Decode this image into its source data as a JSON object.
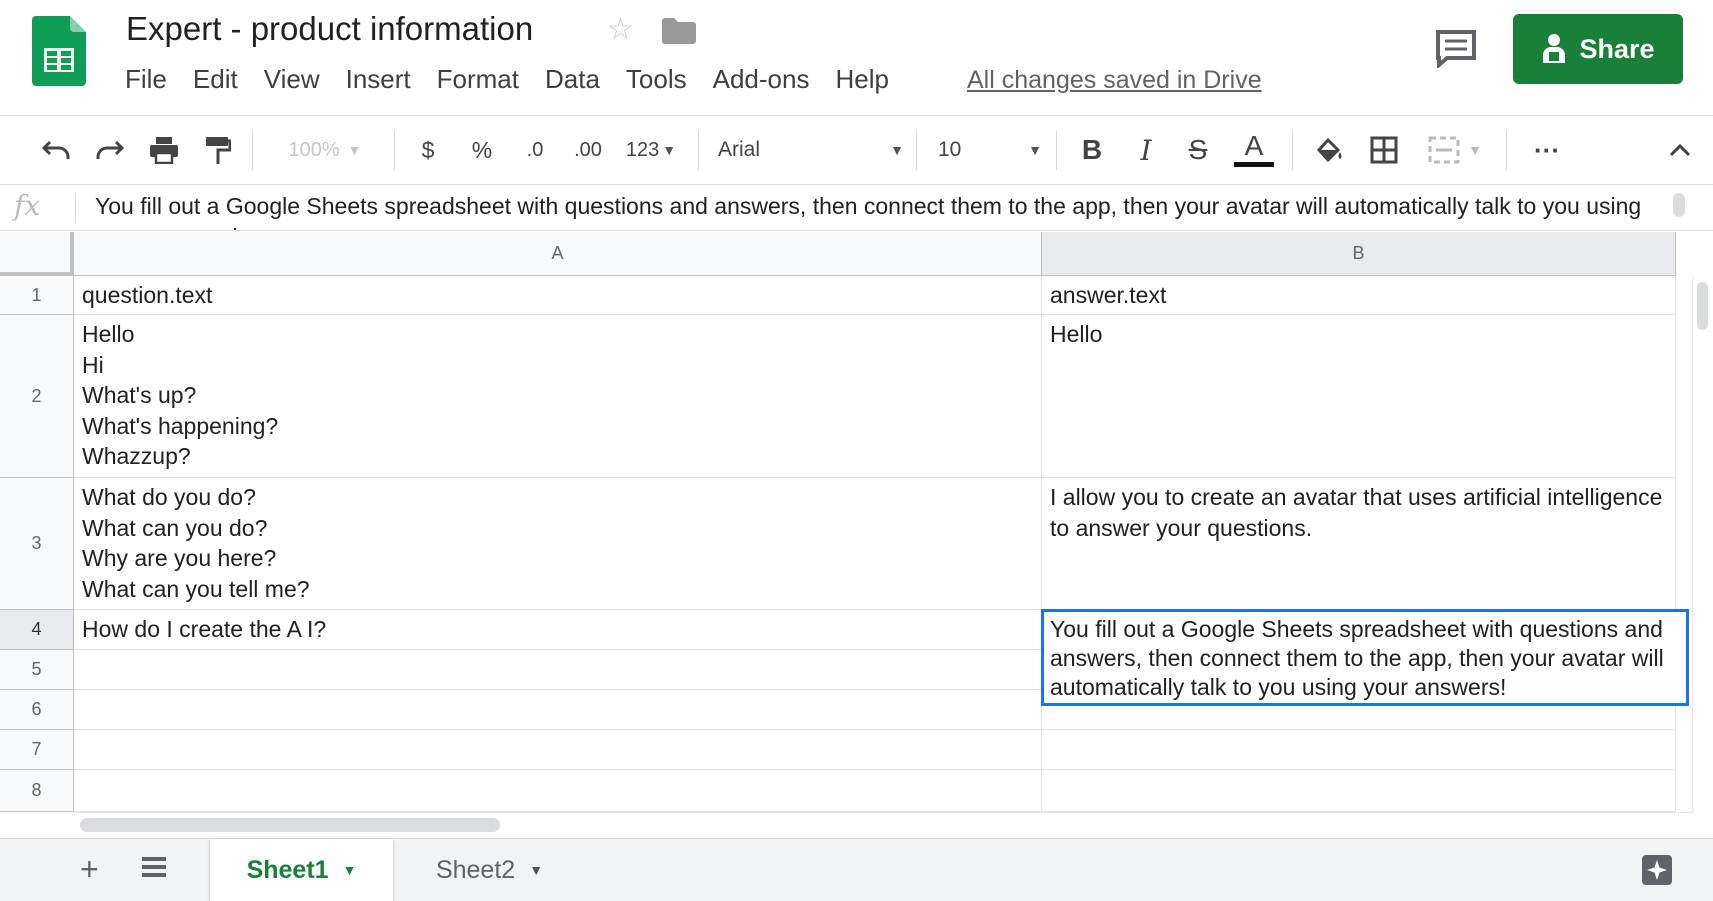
{
  "header": {
    "title": "Expert - product information",
    "menu": [
      "File",
      "Edit",
      "View",
      "Insert",
      "Format",
      "Data",
      "Tools",
      "Add-ons",
      "Help"
    ],
    "saved_status": "All changes saved in Drive",
    "share_label": "Share"
  },
  "toolbar": {
    "zoom": "100%",
    "currency": "$",
    "percent": "%",
    "decrease_decimal": ".0",
    "increase_decimal": ".00",
    "more_formats": "123",
    "font": "Arial",
    "font_size": "10",
    "bold": "B",
    "italic": "I",
    "strikethrough": "S",
    "text_color": "A",
    "more": "···"
  },
  "formula_bar": {
    "fx": "fx",
    "content": "You fill out a Google Sheets spreadsheet with questions and answers, then connect them to the app, then your avatar will automatically talk to you using your answers!"
  },
  "grid": {
    "columns": [
      "A",
      "B"
    ],
    "rows": [
      "1",
      "2",
      "3",
      "4",
      "5",
      "6",
      "7",
      "8"
    ],
    "cells": {
      "A1": "question.text",
      "B1": "answer.text",
      "A2": "Hello\nHi\nWhat's up?\nWhat's happening?\nWhazzup?",
      "B2": "Hello",
      "A3": "What do you do?\nWhat can you do?\nWhy are you here?\nWhat can you tell me?",
      "B3": "I allow you to create an avatar that uses artificial intelligence to answer your questions.",
      "A4": "How do I create the A I?",
      "B4": "You fill out a Google Sheets spreadsheet with questions and answers, then connect them to the app, then your avatar will automatically talk to you using your answers!"
    },
    "active_cell": "B4"
  },
  "sheets": {
    "tabs": [
      "Sheet1",
      "Sheet2"
    ],
    "active": "Sheet1"
  },
  "colors": {
    "share_green": "#188038",
    "selection_blue": "#1a73e8",
    "active_tab_green": "#188038"
  }
}
